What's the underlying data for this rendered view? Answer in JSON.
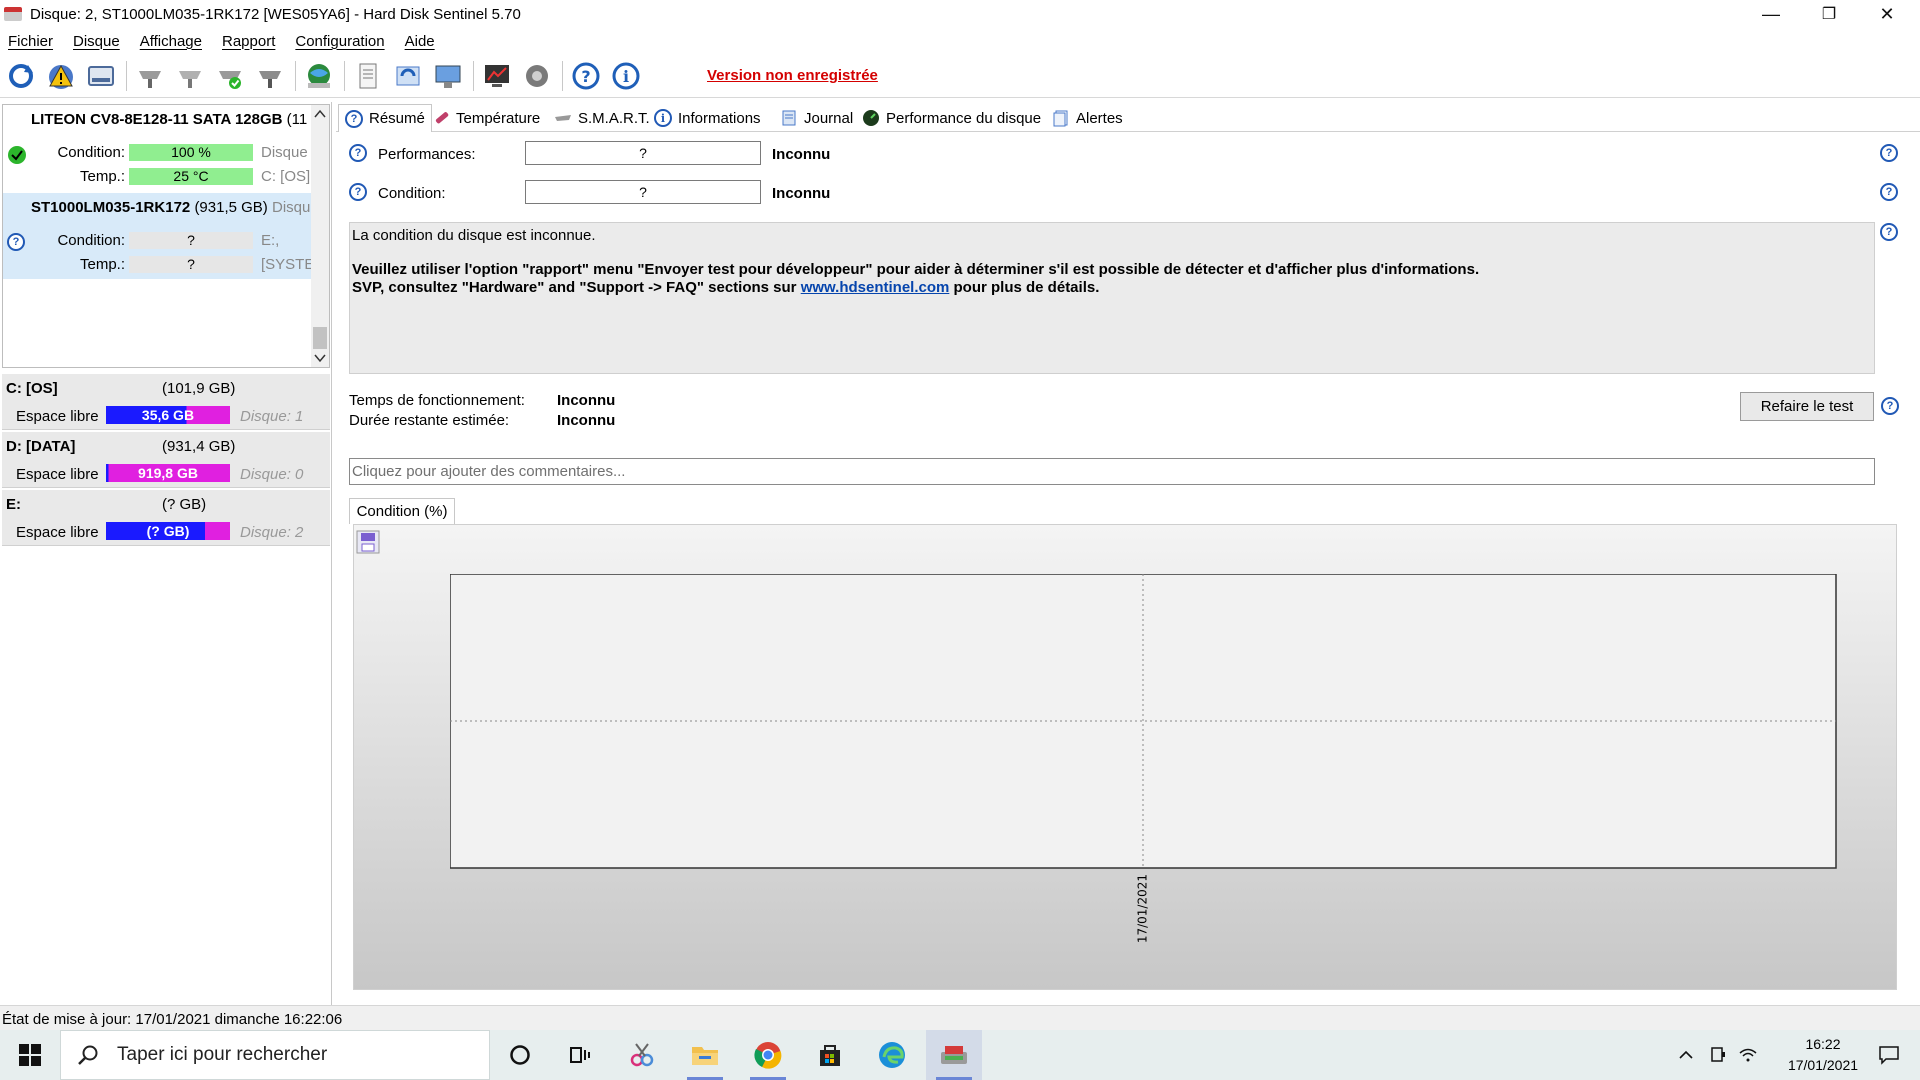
{
  "window": {
    "title": "Disque: 2, ST1000LM035-1RK172 [WES05YA6]  -  Hard Disk Sentinel 5.70",
    "minimize": "—",
    "maximize": "❐",
    "close": "✕"
  },
  "menu": [
    "Fichier",
    "Disque",
    "Affichage",
    "Rapport",
    "Configuration",
    "Aide"
  ],
  "toolbar": {
    "icons": [
      "refresh-icon",
      "alert-icon",
      "disk-icon",
      "drive-tool-1-icon",
      "drive-tool-2-icon",
      "drive-check-icon",
      "drive-tool-4-icon",
      "globe-icon",
      "report-icon",
      "sync-icon",
      "network-icon",
      "monitor-icon",
      "settings-icon",
      "help-icon",
      "info-icon"
    ],
    "unregistered": "Version non enregistrée"
  },
  "disks": [
    {
      "name": "LITEON CV8-8E128-11 SATA 128GB",
      "suffix": "(11",
      "condition_label": "Condition:",
      "condition_value": "100 %",
      "temp_label": "Temp.:",
      "temp_value": "25 °C",
      "right1": "Disque",
      "right2": "C: [OS]",
      "status_color": "#2cb52c"
    },
    {
      "name": "ST1000LM035-1RK172",
      "size": "(931,5 GB)",
      "suffix": "Disqu",
      "condition_label": "Condition:",
      "condition_value": "?",
      "temp_label": "Temp.:",
      "temp_value": "?",
      "right1": "E:,",
      "right2": "[SYSTE"
    }
  ],
  "volumes": [
    {
      "name": "C: [OS]",
      "size": "(101,9 GB)",
      "free_label": "Espace libre",
      "free_value": "35,6 GB",
      "disk": "Disque: 1"
    },
    {
      "name": "D: [DATA]",
      "size": "(931,4 GB)",
      "free_label": "Espace libre",
      "free_value": "919,8 GB",
      "disk": "Disque: 0"
    },
    {
      "name": "E:",
      "size": "(? GB)",
      "free_label": "Espace libre",
      "free_value": "(? GB)",
      "disk": "Disque: 2"
    }
  ],
  "tabs": [
    "Résumé",
    "Température",
    "S.M.A.R.T.",
    "Informations",
    "Journal",
    "Performance du disque",
    "Alertes"
  ],
  "summary": {
    "performances_label": "Performances:",
    "performances_box": "?",
    "performances_value": "Inconnu",
    "condition_label": "Condition:",
    "condition_box": "?",
    "condition_value": "Inconnu",
    "message_line1": "La condition du disque est inconnue.",
    "message_line2": "Veuillez utiliser l'option \"rapport\" menu \"Envoyer test pour développeur\" pour aider à déterminer s'il est possible de détecter et d'afficher plus d'informations.",
    "message_line3_a": "SVP, consultez \"Hardware\" and \"Support -> FAQ\" sections sur",
    "message_link": "www.hdsentinel.com",
    "message_line3_b": "pour plus de détails.",
    "uptime_label": "Temps de fonctionnement:",
    "uptime_value": "Inconnu",
    "remaining_label": "Durée restante estimée:",
    "remaining_value": "Inconnu",
    "retest_button": "Refaire le test",
    "comment_placeholder": "Cliquez pour ajouter des commentaires...",
    "chart_tab": "Condition (%)"
  },
  "chart_data": {
    "type": "line",
    "title": "",
    "xlabel": "",
    "ylabel": "",
    "x": [
      "17/01/2021"
    ],
    "y_ticks": [
      "0"
    ],
    "series": [],
    "grid": true
  },
  "status": "État de mise à jour: 17/01/2021 dimanche 16:22:06",
  "taskbar": {
    "search_placeholder": "Taper ici pour rechercher",
    "time": "16:22",
    "date": "17/01/2021"
  },
  "colors": {
    "green_bar": "#90ee90",
    "blue_bar": "#1a1aff",
    "magenta_bar": "#e020e0",
    "unregistered": "#d40000",
    "link": "#0645ad"
  }
}
